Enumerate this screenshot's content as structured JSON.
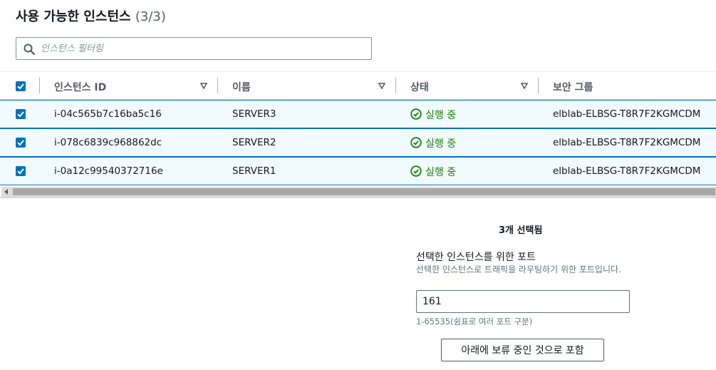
{
  "panel": {
    "title": "사용 가능한 인스턴스",
    "count": "(3/3)"
  },
  "search": {
    "placeholder": "인스턴스 필터링",
    "value": ""
  },
  "table": {
    "columns": [
      "인스턴스 ID",
      "이름",
      "상태",
      "보안 그룹"
    ],
    "rows": [
      {
        "id": "i-04c565b7c16ba5c16",
        "name": "SERVER3",
        "status": "실행 중",
        "security_group": "elblab-ELBSG-T8R7F2KGMCDM",
        "selected": true
      },
      {
        "id": "i-078c6839c968862dc",
        "name": "SERVER2",
        "status": "실행 중",
        "security_group": "elblab-ELBSG-T8R7F2KGMCDM",
        "selected": true
      },
      {
        "id": "i-0a12c99540372716e",
        "name": "SERVER1",
        "status": "실행 중",
        "security_group": "elblab-ELBSG-T8R7F2KGMCDM",
        "selected": true
      }
    ],
    "all_selected": true
  },
  "selection": {
    "summary": "3개 선택됨"
  },
  "port": {
    "label": "선택한 인스턴스를 위한 포트",
    "description": "선택한 인스턴스로 트래픽을 라우팅하기 위한 포트입니다.",
    "value": "161",
    "hint": "1-65535(쉼표로 여러 포트 구분)"
  },
  "include_button": {
    "label": "아래에 보류 중인 것으로 포함"
  },
  "colors": {
    "accent": "#0073bb",
    "selected_row_bg": "#f1faff",
    "status_running": "#1d8102"
  },
  "icons": {
    "search": "search-icon",
    "sort": "sort-caret-icon",
    "status": "check-circle-icon",
    "checkbox": "checkbox-checked"
  }
}
